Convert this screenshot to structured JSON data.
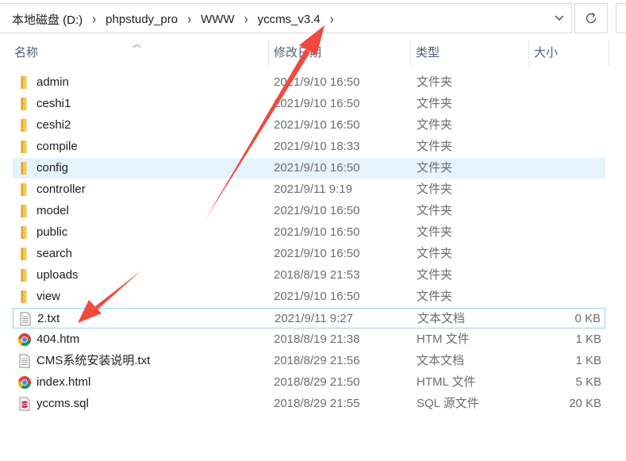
{
  "address_bar": {
    "crumbs": [
      "本地磁盘 (D:)",
      "phpstudy_pro",
      "WWW",
      "yccms_v3.4"
    ]
  },
  "columns": {
    "name": "名称",
    "date": "修改日期",
    "type": "类型",
    "size": "大小"
  },
  "files": [
    {
      "name": "admin",
      "date": "2021/9/10 16:50",
      "type": "文件夹",
      "size": "",
      "icon": "folder-icon"
    },
    {
      "name": "ceshi1",
      "date": "2021/9/10 16:50",
      "type": "文件夹",
      "size": "",
      "icon": "folder-icon"
    },
    {
      "name": "ceshi2",
      "date": "2021/9/10 16:50",
      "type": "文件夹",
      "size": "",
      "icon": "folder-icon"
    },
    {
      "name": "compile",
      "date": "2021/9/10 18:33",
      "type": "文件夹",
      "size": "",
      "icon": "folder-icon"
    },
    {
      "name": "config",
      "date": "2021/9/10 16:50",
      "type": "文件夹",
      "size": "",
      "icon": "folder-icon"
    },
    {
      "name": "controller",
      "date": "2021/9/11 9:19",
      "type": "文件夹",
      "size": "",
      "icon": "folder-icon"
    },
    {
      "name": "model",
      "date": "2021/9/10 16:50",
      "type": "文件夹",
      "size": "",
      "icon": "folder-icon"
    },
    {
      "name": "public",
      "date": "2021/9/10 16:50",
      "type": "文件夹",
      "size": "",
      "icon": "folder-icon"
    },
    {
      "name": "search",
      "date": "2021/9/10 16:50",
      "type": "文件夹",
      "size": "",
      "icon": "folder-icon"
    },
    {
      "name": "uploads",
      "date": "2018/8/19 21:53",
      "type": "文件夹",
      "size": "",
      "icon": "folder-icon"
    },
    {
      "name": "view",
      "date": "2021/9/10 16:50",
      "type": "文件夹",
      "size": "",
      "icon": "folder-icon"
    },
    {
      "name": "2.txt",
      "date": "2021/9/11 9:27",
      "type": "文本文档",
      "size": "0 KB",
      "icon": "text-file-icon"
    },
    {
      "name": "404.htm",
      "date": "2018/8/19 21:38",
      "type": "HTM 文件",
      "size": "1 KB",
      "icon": "chrome-icon"
    },
    {
      "name": "CMS系统安装说明.txt",
      "date": "2018/8/29 21:56",
      "type": "文本文档",
      "size": "1 KB",
      "icon": "text-file-icon"
    },
    {
      "name": "index.html",
      "date": "2018/8/29 21:50",
      "type": "HTML 文件",
      "size": "5 KB",
      "icon": "chrome-icon"
    },
    {
      "name": "yccms.sql",
      "date": "2018/8/29 21:55",
      "type": "SQL 源文件",
      "size": "20 KB",
      "icon": "sql-file-icon"
    }
  ],
  "state": {
    "selected_item": "config",
    "focused_item": "2.txt"
  },
  "colors": {
    "annotation_arrow": "#f04a3e",
    "selection": "#e5f3ff",
    "focus_border": "#99d1ff",
    "folder": "#f8c74e"
  }
}
